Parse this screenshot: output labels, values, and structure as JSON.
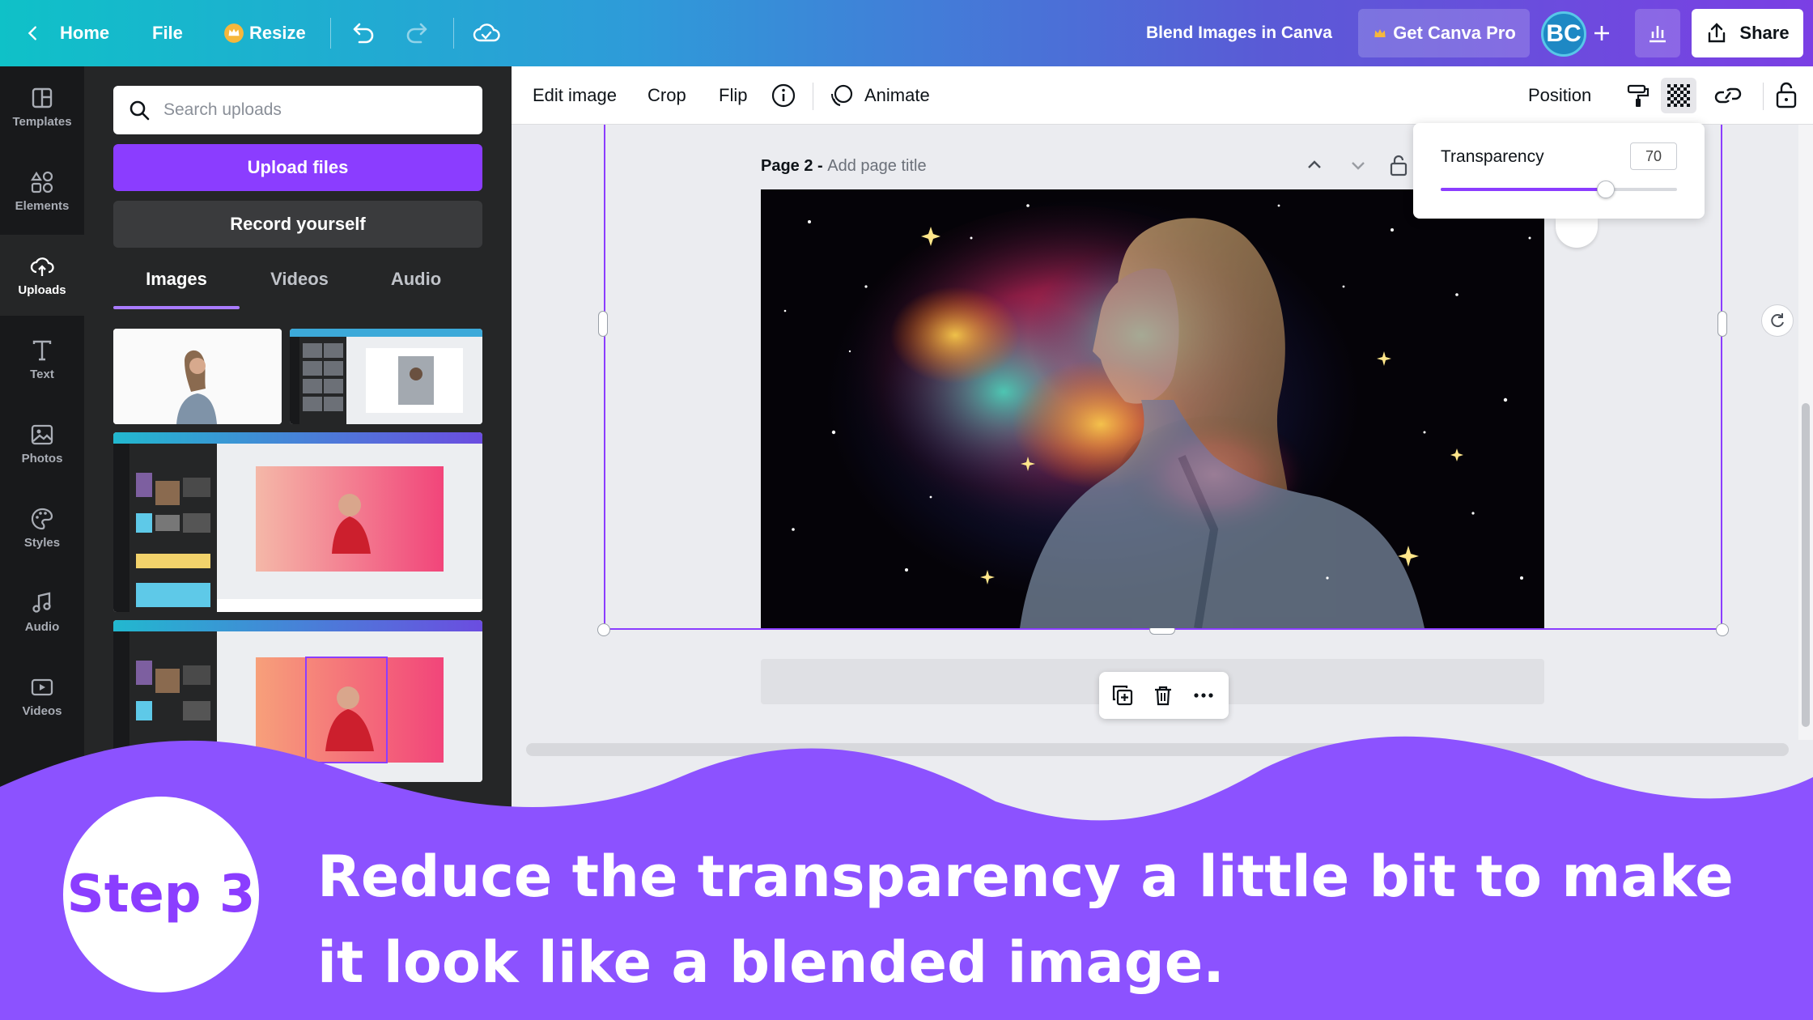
{
  "topbar": {
    "home_label": "Home",
    "file_label": "File",
    "resize_label": "Resize",
    "doc_title": "Blend Images in Canva",
    "get_pro_label": "Get Canva Pro",
    "avatar_initials": "BC",
    "share_label": "Share"
  },
  "rail": {
    "items": [
      {
        "label": "Templates",
        "icon": "templates-icon"
      },
      {
        "label": "Elements",
        "icon": "elements-icon"
      },
      {
        "label": "Uploads",
        "icon": "upload-cloud-icon"
      },
      {
        "label": "Text",
        "icon": "text-icon"
      },
      {
        "label": "Photos",
        "icon": "photos-icon"
      },
      {
        "label": "Styles",
        "icon": "palette-icon"
      },
      {
        "label": "Audio",
        "icon": "music-note-icon"
      },
      {
        "label": "Videos",
        "icon": "video-icon"
      }
    ]
  },
  "panel": {
    "search_placeholder": "Search uploads",
    "upload_label": "Upload files",
    "record_label": "Record yourself",
    "tabs": [
      "Images",
      "Videos",
      "Audio"
    ],
    "active_tab": "Images"
  },
  "toolbar": {
    "edit_image": "Edit image",
    "crop": "Crop",
    "flip": "Flip",
    "animate": "Animate",
    "position": "Position"
  },
  "canvas": {
    "page_label": "Page 2 - ",
    "page_title_placeholder": "Add page title"
  },
  "transparency": {
    "label": "Transparency",
    "value": "70",
    "level": 0.7
  },
  "overlay": {
    "step_label": "Step 3",
    "caption": "Reduce the transparency a little bit to make it look like a blended image."
  },
  "colors": {
    "accent": "#8b3dff",
    "wave": "#8c52ff"
  }
}
